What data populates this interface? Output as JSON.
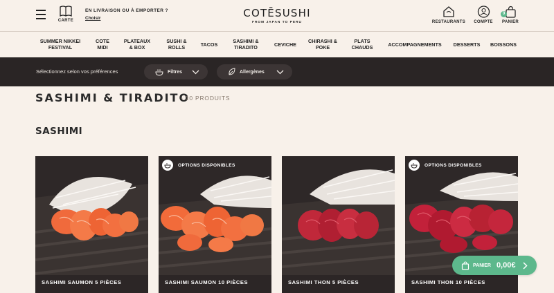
{
  "header": {
    "menu_icon": "hamburger-icon",
    "carte": {
      "label": "CARTE",
      "icon": "book-icon"
    },
    "delivery": {
      "line1": "EN LIVRAISON OU À EMPORTER ?",
      "choose": "Choisir"
    },
    "logo": {
      "brand": "COTĒSUSHI",
      "tagline": "FROM JAPAN TO PERU"
    },
    "actions": [
      {
        "label": "RESTAURANTS",
        "icon": "restaurant-icon"
      },
      {
        "label": "COMPTE",
        "icon": "user-icon"
      },
      {
        "label": "PANIER",
        "icon": "bag-icon",
        "badge": "0"
      }
    ]
  },
  "categories": [
    {
      "label": "SUMMER NIKKEI\nFESTIVAL"
    },
    {
      "label": "COTE\nMIDI"
    },
    {
      "label": "PLATEAUX\n& BOX"
    },
    {
      "label": "SUSHI &\nROLLS"
    },
    {
      "label": "TACOS"
    },
    {
      "label": "SASHIMI &\nTIRADITO"
    },
    {
      "label": "CEVICHE"
    },
    {
      "label": "CHIRASHI &\nPOKE"
    },
    {
      "label": "PLATS\nCHAUDS"
    },
    {
      "label": "ACCOMPAGNEMENTS"
    },
    {
      "label": "DESSERTS"
    },
    {
      "label": "BOISSONS"
    }
  ],
  "filters": {
    "prompt": "Sélectionnez selon vos préférences",
    "filters_label": "Filtres",
    "allergens_label": "Allergènes"
  },
  "page": {
    "title": "SASHIMI & TIRADITO",
    "count": "- 10 PRODUITS",
    "section": "SASHIMI"
  },
  "products": [
    {
      "name": "SASHIMI SAUMON 5 PIÈCES",
      "options": "",
      "fish_color": "#f06a3c"
    },
    {
      "name": "SASHIMI SAUMON 10 PIÈCES",
      "options": "OPTIONS DISPONIBLES",
      "fish_color": "#f26b3a"
    },
    {
      "name": "SASHIMI THON 5 PIÈCES",
      "options": "",
      "fish_color": "#c0283a"
    },
    {
      "name": "SASHIMI THON 10 PIÈCES",
      "options": "OPTIONS DISPONIBLES",
      "fish_color": "#c2213a"
    }
  ],
  "floating_cart": {
    "label": "PANIER",
    "amount": "0,00€"
  },
  "colors": {
    "accent": "#5db88c",
    "dark_bar": "#2a2525",
    "background": "#f8f1ea"
  }
}
